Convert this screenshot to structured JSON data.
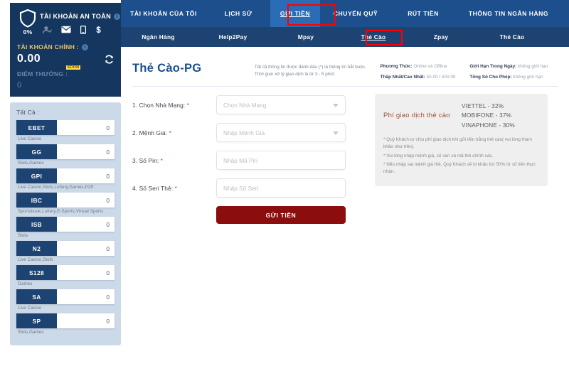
{
  "account": {
    "safe_title": "TÀI KHOẢN AN TOÀN",
    "percent": "0%",
    "main_label": "TÀI KHOẢN CHÍNH :",
    "balance": "0.00",
    "points_label": "ĐIỂM THƯỞNG :",
    "points_badge": "SOON",
    "points_value": "0",
    "icons": [
      "shield-icon",
      "user-verify-icon",
      "envelope-icon",
      "phone-icon",
      "dollar-icon",
      "refresh-icon",
      "info-icon"
    ]
  },
  "sidebar": {
    "all_label": "Tất Cả :",
    "games": [
      {
        "tag": "EBET",
        "value": "0",
        "sub": "Live Casino"
      },
      {
        "tag": "GG",
        "value": "0",
        "sub": "Slots,Games"
      },
      {
        "tag": "GPI",
        "value": "0",
        "sub": "Live Casino,Slots,Lottery,Games,P2P"
      },
      {
        "tag": "IBC",
        "value": "0",
        "sub": "Sportsbook,Lottery,E-Sports,Virtual Sports"
      },
      {
        "tag": "ISB",
        "value": "0",
        "sub": "Slots"
      },
      {
        "tag": "N2",
        "value": "0",
        "sub": "Live Casino,Slots"
      },
      {
        "tag": "S128",
        "value": "0",
        "sub": "Games"
      },
      {
        "tag": "SA",
        "value": "0",
        "sub": "Live Casino"
      },
      {
        "tag": "SP",
        "value": "0",
        "sub": "Slots,Games"
      }
    ]
  },
  "nav": {
    "main": [
      {
        "id": "my-account",
        "label": "TÀI KHOẢN CỦA TÔI",
        "active": false
      },
      {
        "id": "history",
        "label": "LỊCH SỬ",
        "active": false
      },
      {
        "id": "deposit",
        "label": "GỬI TIỀN",
        "active": true
      },
      {
        "id": "transfer",
        "label": "CHUYỂN QUỸ",
        "active": false
      },
      {
        "id": "withdraw",
        "label": "RÚT TIỀN",
        "active": false
      },
      {
        "id": "bankinfo",
        "label": "THÔNG TIN NGÂN HÀNG",
        "active": false
      }
    ],
    "sub": [
      {
        "id": "nganhang",
        "label": "Ngân Hàng",
        "active": false
      },
      {
        "id": "help2pay",
        "label": "Help2Pay",
        "active": false
      },
      {
        "id": "mpay",
        "label": "Mpay",
        "active": false
      },
      {
        "id": "thecao1",
        "label": "Thẻ Cào",
        "active": true
      },
      {
        "id": "zpay",
        "label": "Zpay",
        "active": false
      },
      {
        "id": "thecao2",
        "label": "Thẻ Cào",
        "active": false
      }
    ]
  },
  "page": {
    "title": "Thẻ Cào-PG",
    "note_line1": "Tất cả thông tin được đánh dấu (*) là thông tin bắt buộc.",
    "note_line2": "Thời gian xử lý giao dịch là từ 3 - 5 phút.",
    "meta": [
      {
        "label": "Phương Thức:",
        "value": "Online và Offline"
      },
      {
        "label": "Thấp Nhất/Cao Nhất:",
        "value": "50.00 / 500.00"
      },
      {
        "label": "Giới Hạn Trong Ngày:",
        "value": "không giới hạn"
      },
      {
        "label": "Tổng Số Cho Phép:",
        "value": "không giới hạn"
      }
    ]
  },
  "form": {
    "fields": [
      {
        "label": "1. Chọn Nhà Mạng:",
        "required": "*",
        "placeholder": "Chọn Nhà Mạng",
        "value": "",
        "type": "select"
      },
      {
        "label": "2. Mệnh Giá:",
        "required": "*",
        "placeholder": "Nhập Mệnh Giá",
        "value": "",
        "type": "select"
      },
      {
        "label": "3. Số Pin:",
        "required": "*",
        "placeholder": "Nhập Mã Pin",
        "value": "",
        "type": "text"
      },
      {
        "label": "4. Số Seri Thẻ:",
        "required": "*",
        "placeholder": "Nhập Số Seri",
        "value": "",
        "type": "text"
      }
    ],
    "submit_label": "GỬI TIỀN"
  },
  "fee_panel": {
    "title": "Phí giao dịch thẻ cào",
    "rates": [
      "VIETTEL - 32%",
      "MOBIFONE - 37%",
      "VINAPHONE - 30%"
    ],
    "notes": [
      "* Quý Khách tự chịu phí giao dịch khi gửi tiền bằng thẻ cào( vui lòng tham khảo như trên).",
      "* Vui lòng nhập mệnh giá, số seri và mã thẻ chính xác.",
      "* Nếu nhập sai mệnh giá thẻ, Quý Khách sẽ bị khấu trừ 50% từ số tiền thực nhận."
    ]
  },
  "colors": {
    "navy_dark": "#14365f",
    "navy": "#1c4372",
    "nav_blue": "#1d4f8c",
    "nav_active": "#2a6cb5",
    "sidebar_bg": "#ccd9e8",
    "highlight_red": "#ff0000",
    "submit_red": "#8b0d0d",
    "gold": "#e8c26a",
    "fee_title": "#a0522d"
  }
}
